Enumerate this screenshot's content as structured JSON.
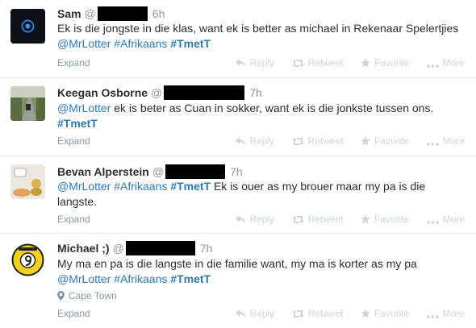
{
  "tweets": [
    {
      "name": "Sam",
      "at": "@",
      "time": "6h",
      "text_parts": [
        "Ek is die jongste in die klas, want ek is better as michael in Rekenaar Spelertjies ",
        "@MrLotter",
        " ",
        "#Afrikaans",
        " ",
        "#TmetT",
        ""
      ],
      "expand": "Expand"
    },
    {
      "name": "Keegan Osborne",
      "at": "@",
      "time": "7h",
      "text_parts": [
        "@MrLotter",
        " ek is beter as Cuan in sokker, want ek is die jonkste tussen ons. ",
        "#TmetT"
      ],
      "expand": "Expand"
    },
    {
      "name": "Bevan Alperstein",
      "at": "@",
      "time": "7h",
      "text_parts": [
        "@MrLotter",
        " ",
        "#Afrikaans",
        " ",
        "#TmetT",
        " Ek is ouer as my brouer maar my pa is die langste."
      ],
      "expand": "Expand"
    },
    {
      "name": "Michael ;)",
      "at": "@",
      "time": "7h",
      "text_parts": [
        "My ma en pa is die langste in die familie want, my ma is korter as my pa ",
        "@MrLotter",
        " ",
        "#Afrikaans",
        " ",
        "#TmetT"
      ],
      "location": "Cape Town",
      "expand": "Expand"
    }
  ],
  "actions": {
    "reply": "Reply",
    "retweet": "Retweet",
    "favorite": "Favorite",
    "more": "More"
  },
  "icons": [
    "reply-icon",
    "retweet-icon",
    "favorite-star-icon",
    "more-dots-icon",
    "location-pin-icon"
  ],
  "colors": {
    "link": "#2b7bb9",
    "muted": "#8899a6",
    "action": "#ccd6dd",
    "text": "#292f33"
  }
}
